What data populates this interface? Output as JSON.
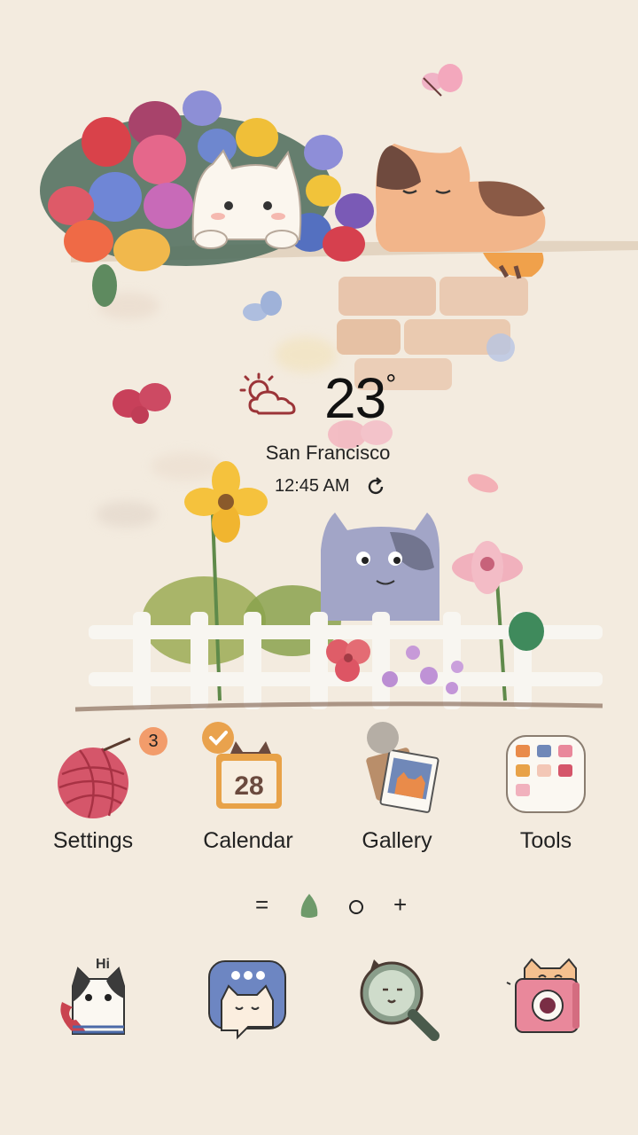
{
  "weather": {
    "temperature": "23",
    "unit": "°",
    "city": "San Francisco",
    "time": "12:45 AM",
    "condition_icon": "sun-behind-cloud-icon"
  },
  "apps": [
    {
      "label": "Settings",
      "icon": "yarn-ball-icon",
      "badge": "3"
    },
    {
      "label": "Calendar",
      "icon": "calendar-cat-icon",
      "calendar_day": "28"
    },
    {
      "label": "Gallery",
      "icon": "photo-frame-cat-icon"
    },
    {
      "label": "Tools",
      "icon": "tools-folder-icon"
    }
  ],
  "pager": {
    "menu_glyph": "=",
    "plus_glyph": "+"
  },
  "dock": [
    {
      "icon": "phone-cat-icon",
      "greeting": "Hi"
    },
    {
      "icon": "message-cat-icon"
    },
    {
      "icon": "search-magnifier-cat-icon"
    },
    {
      "icon": "camera-cat-icon"
    }
  ],
  "colors": {
    "background": "#f3ebdf",
    "badge": "#f29c6b",
    "check_badge": "#e9a24d",
    "yarn": "#d5566a",
    "calendar": "#e8a248",
    "message": "#6d86c2",
    "camera": "#e9889b"
  }
}
